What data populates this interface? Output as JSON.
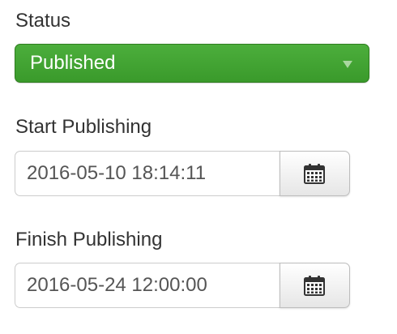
{
  "status": {
    "label": "Status",
    "selected": "Published",
    "color": "#43a536"
  },
  "start_publishing": {
    "label": "Start Publishing",
    "value": "2016-05-10 18:14:11",
    "button_icon": "calendar-icon"
  },
  "finish_publishing": {
    "label": "Finish Publishing",
    "value": "2016-05-24 12:00:00",
    "button_icon": "calendar-icon"
  }
}
